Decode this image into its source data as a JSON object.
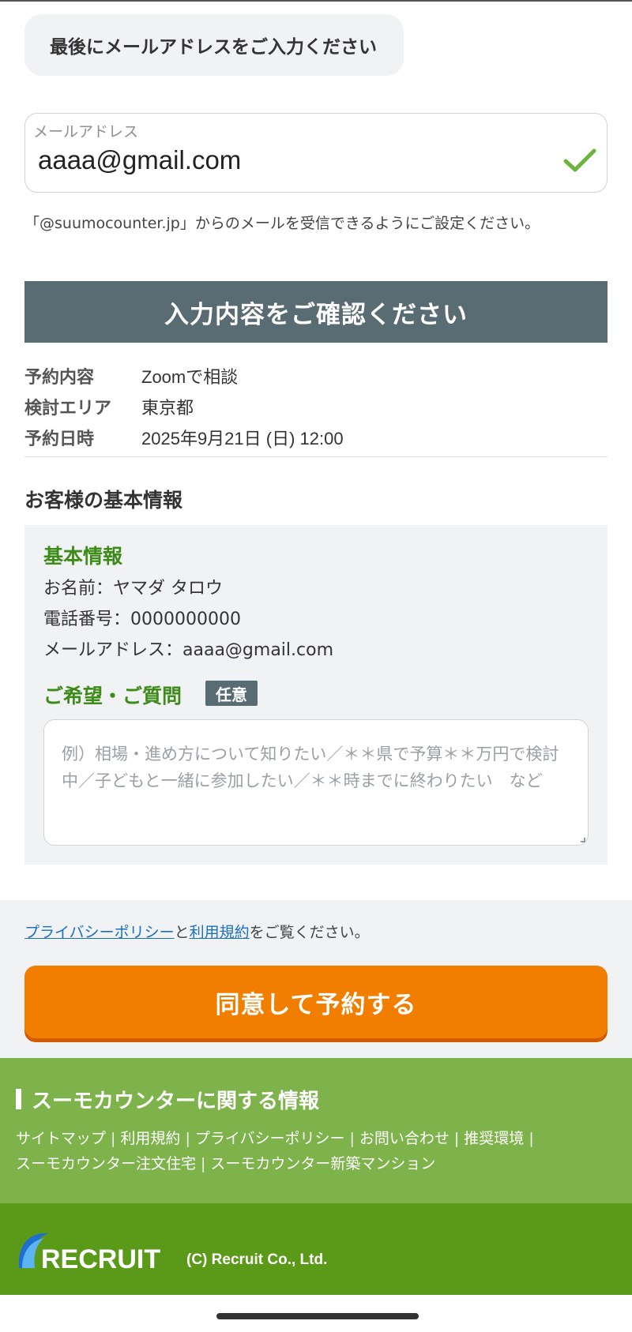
{
  "prompt": {
    "text": "最後にメールアドレスをご入力ください"
  },
  "email": {
    "label": "メールアドレス",
    "value": "aaaa@gmail.com",
    "valid_icon": "check-icon",
    "note": "「@suumocounter.jp」からのメールを受信できるようにご設定ください。"
  },
  "confirm": {
    "header": "入力内容をご確認ください",
    "rows": [
      {
        "key": "予約内容",
        "value": "Zoomで相談"
      },
      {
        "key": "検討エリア",
        "value": "東京都"
      },
      {
        "key": "予約日時",
        "value": "2025年9月21日 (日) 12:00"
      }
    ]
  },
  "customer": {
    "section_title": "お客様の基本情報",
    "basic_heading": "基本情報",
    "name_line": "お名前：ヤマダ タロウ",
    "phone_line": "電話番号：0000000000",
    "email_line": "メールアドレス：aaaa@gmail.com",
    "wish_title": "ご希望・ご質問",
    "optional_badge": "任意",
    "wish_placeholder": "例）相場・進め方について知りたい／＊＊県で予算＊＊万円で検討中／子どもと一緒に参加したい／＊＊時までに終わりたい　など"
  },
  "agree": {
    "privacy_link": "プライバシーポリシー",
    "and_text": "と",
    "terms_link": "利用規約",
    "suffix_text": "をご覧ください。",
    "button": "同意して予約する"
  },
  "footer": {
    "title": "スーモカウンターに関する情報",
    "links_row1": [
      "サイトマップ",
      "利用規約",
      "プライバシーポリシー",
      "お問い合わせ",
      "推奨環境"
    ],
    "links_row2": [
      "スーモカウンター注文住宅",
      "スーモカウンター新築マンション"
    ],
    "logo_text": "RECRUIT",
    "copyright": "(C) Recruit Co., Ltd."
  },
  "colors": {
    "accent_green": "#3d8c1a",
    "button_orange": "#f27e00",
    "header_gray": "#5a6c73",
    "footer_green": "#7db34a",
    "footer_dark_green": "#5a9a18",
    "link_blue": "#1a6fc4"
  }
}
